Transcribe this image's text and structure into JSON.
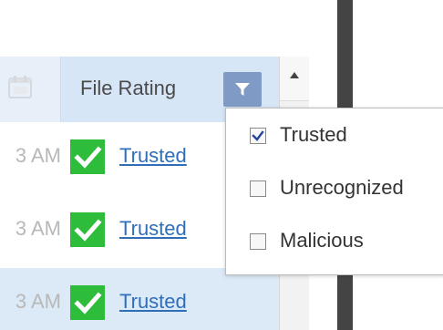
{
  "grid": {
    "column": {
      "label": "File Rating"
    },
    "rows": [
      {
        "time_text": "3 AM",
        "rating": "Trusted"
      },
      {
        "time_text": "3 AM",
        "rating": "Trusted"
      },
      {
        "time_text": "3 AM",
        "rating": "Trusted"
      }
    ]
  },
  "filter_menu": {
    "options": [
      {
        "label": "Trusted",
        "checked": true
      },
      {
        "label": "Unrecognized",
        "checked": false
      },
      {
        "label": "Malicious",
        "checked": false
      }
    ]
  },
  "icons": {
    "calendar": "calendar-icon",
    "filter": "filter-icon",
    "scroll_up": "chevron-up-icon",
    "trusted": "check-icon"
  },
  "colors": {
    "header": "#d7e6f7",
    "filter_button": "#7f9ac4",
    "link": "#2f6fb8",
    "trusted_badge": "#2ebd3a",
    "dark_panel": "#444444"
  }
}
